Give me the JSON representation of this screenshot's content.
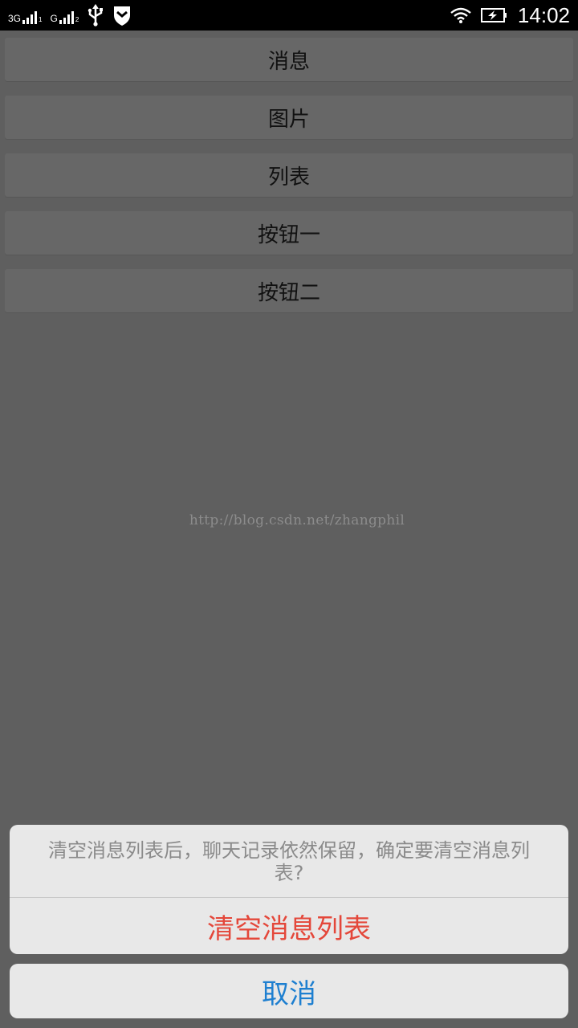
{
  "status_bar": {
    "sim1_label": "3G",
    "sim1_slot": "1",
    "sim2_label": "G",
    "sim2_slot": "2",
    "icons": [
      "signal-icon",
      "usb-icon",
      "shield-icon",
      "wifi-icon",
      "battery-charging-icon"
    ],
    "time": "14:02"
  },
  "buttons": {
    "message": "消息",
    "picture": "图片",
    "list": "列表",
    "button_one": "按钮一",
    "button_two": "按钮二"
  },
  "watermark": "http://blog.csdn.net/zhangphil",
  "action_sheet": {
    "message": "清空消息列表后，聊天记录依然保留，确定要清空消息列表?",
    "confirm_label": "清空消息列表",
    "cancel_label": "取消"
  },
  "colors": {
    "overlay_background": "#5f5f5f",
    "destructive": "#e4473a",
    "cancel": "#1e7fd0",
    "sheet_background": "#e8e8e8"
  }
}
